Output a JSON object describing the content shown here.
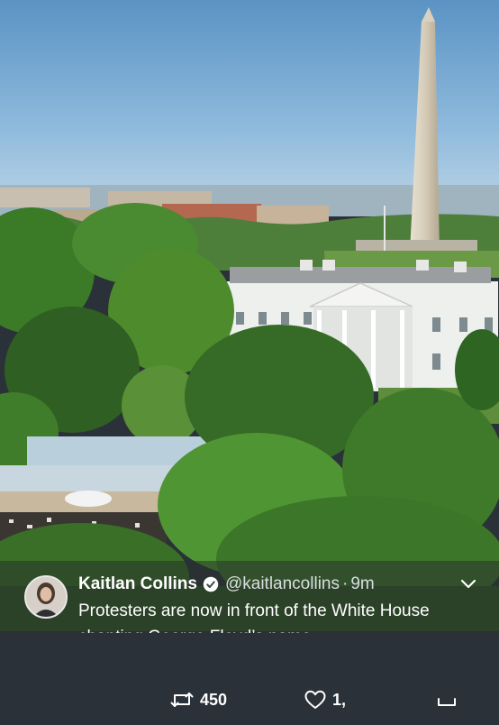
{
  "tweet": {
    "author_name": "Kaitlan Collins",
    "verified_icon": "verified-badge-icon",
    "handle": "@kaitlancollins",
    "separator": "·",
    "time_ago": "9m",
    "text": "Protesters are now in front of the White House chanting George Floyd’s name.",
    "menu_icon": "chevron-down-icon"
  },
  "actions": {
    "retweet_icon": "retweet-icon",
    "retweet_count": "450",
    "like_icon": "heart-icon",
    "like_count": "1,",
    "share_icon": "share-icon"
  },
  "colors": {
    "sky": "#6fa3cf",
    "foliage": "#3f7d2a",
    "overlay_text": "#ffffff",
    "action_bar": "#2b3138"
  }
}
